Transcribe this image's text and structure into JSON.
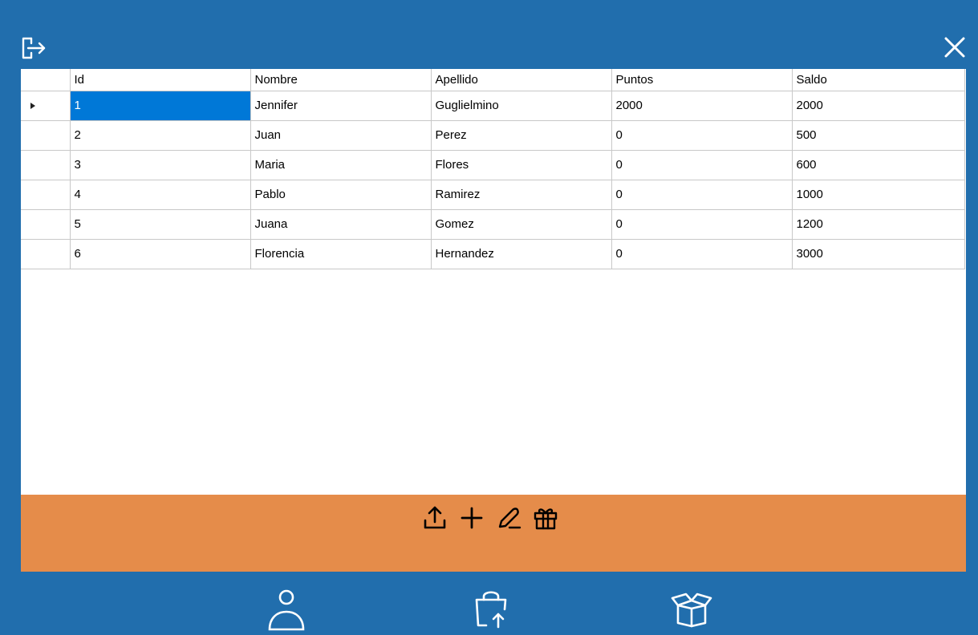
{
  "colors": {
    "window_background": "#216ead",
    "grid_background": "#ffffff",
    "action_bar": "#e58c4a",
    "selected_cell": "#0078d7"
  },
  "toolbar": {
    "logout_icon": "logout-arrow-icon",
    "close_icon": "close-x-icon"
  },
  "grid": {
    "columns": [
      "Id",
      "Nombre",
      "Apellido",
      "Puntos",
      "Saldo"
    ],
    "selected_row": 0,
    "rows": [
      [
        "1",
        "Jennifer",
        "Guglielmino",
        "2000",
        "2000"
      ],
      [
        "2",
        "Juan",
        "Perez",
        "0",
        "500"
      ],
      [
        "3",
        "Maria",
        "Flores",
        "0",
        "600"
      ],
      [
        "4",
        "Pablo",
        "Ramirez",
        "0",
        "1000"
      ],
      [
        "5",
        "Juana",
        "Gomez",
        "0",
        "1200"
      ],
      [
        "6",
        "Florencia",
        "Hernandez",
        "0",
        "3000"
      ]
    ]
  },
  "actions": [
    "upload-icon",
    "plus-icon",
    "pencil-icon",
    "gift-icon"
  ],
  "bottom_nav": [
    "user-icon",
    "shopping-bag-upload-icon",
    "open-box-icon"
  ]
}
